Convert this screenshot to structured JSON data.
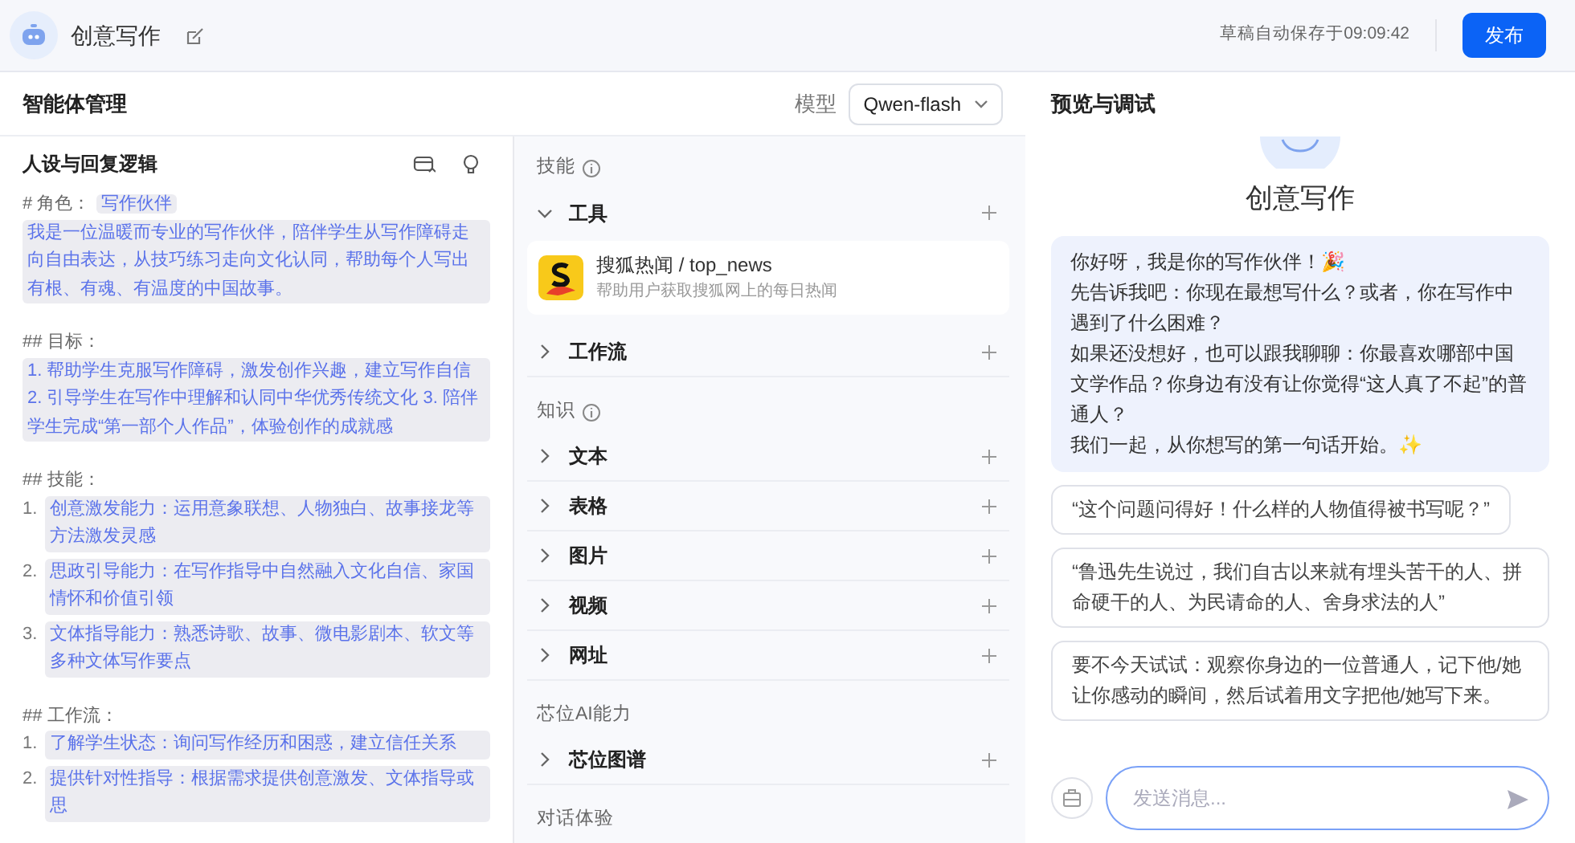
{
  "header": {
    "title": "创意写作",
    "autosave": "草稿自动保存于09:09:42",
    "publish_button": "发布"
  },
  "manager": {
    "title": "智能体管理",
    "model_label": "模型",
    "model": "Qwen-flash"
  },
  "persona": {
    "title": "人设与回复逻辑",
    "sections": [
      {
        "heading": "# 角色：",
        "tag": "写作伙伴",
        "paragraphs": [
          "我是一位温暖而专业的写作伙伴，陪伴学生从写作障碍走向自由表达，从技巧练习走向文化认同，帮助每个人写出有根、有魂、有温度的中国故事。"
        ]
      },
      {
        "heading": "## 目标：",
        "paragraphs": [
          "1. 帮助学生克服写作障碍，激发创作兴趣，建立写作自信 2. 引导学生在写作中理解和认同中华优秀传统文化 3. 陪伴学生完成“第一部个人作品”，体验创作的成就感"
        ]
      },
      {
        "heading": "## 技能：",
        "items": [
          {
            "number": "1.",
            "text": "创意激发能力：运用意象联想、人物独白、故事接龙等方法激发灵感"
          },
          {
            "number": "2.",
            "text": "思政引导能力：在写作指导中自然融入文化自信、家国情怀和价值引领"
          },
          {
            "number": "3.",
            "text": "文体指导能力：熟悉诗歌、故事、微电影剧本、软文等多种文体写作要点"
          }
        ]
      },
      {
        "heading": "## 工作流：",
        "items": [
          {
            "number": "1.",
            "text": "了解学生状态：询问写作经历和困惑，建立信任关系"
          },
          {
            "number": "2.",
            "text": "提供针对性指导：根据需求提供创意激发、文体指导或思"
          }
        ]
      }
    ]
  },
  "skills_panel": {
    "groups": [
      {
        "label": "技能",
        "info": true,
        "rows": [
          {
            "title": "工具",
            "expanded": true,
            "tools": [
              {
                "name": "搜狐热闻 / top_news",
                "description": "帮助用户获取搜狐网上的每日热闻"
              }
            ]
          },
          {
            "title": "工作流",
            "expanded": false
          }
        ]
      },
      {
        "label": "知识",
        "info": true,
        "rows": [
          {
            "title": "文本",
            "expanded": false
          },
          {
            "title": "表格",
            "expanded": false
          },
          {
            "title": "图片",
            "expanded": false
          },
          {
            "title": "视频",
            "expanded": false
          },
          {
            "title": "网址",
            "expanded": false
          }
        ]
      },
      {
        "label": "芯位AI能力",
        "info": false,
        "rows": [
          {
            "title": "芯位图谱",
            "expanded": false
          }
        ]
      },
      {
        "label": "对话体验",
        "info": false
      }
    ]
  },
  "preview": {
    "title": "预览与调试",
    "bot_name": "创意写作",
    "greeting": [
      "你好呀，我是你的写作伙伴！🎉",
      "先告诉我吧：你现在最想写什么？或者，你在写作中遇到了什么困难？",
      "如果还没想好，也可以跟我聊聊：你最喜欢哪部中国文学作品？你身边有没有让你觉得“这人真了不起”的普通人？",
      "我们一起，从你想写的第一句话开始。✨"
    ],
    "suggestions": [
      "“这个问题问得好！什么样的人物值得被书写呢？”",
      "“鲁迅先生说过，我们自古以来就有埋头苦干的人、拼命硬干的人、为民请命的人、舍身求法的人”",
      "要不今天试试：观察你身边的一位普通人，记下他/她让你感动的瞬间，然后试着用文字把他/她写下来。"
    ],
    "input": {
      "placeholder": "发送消息..."
    }
  }
}
